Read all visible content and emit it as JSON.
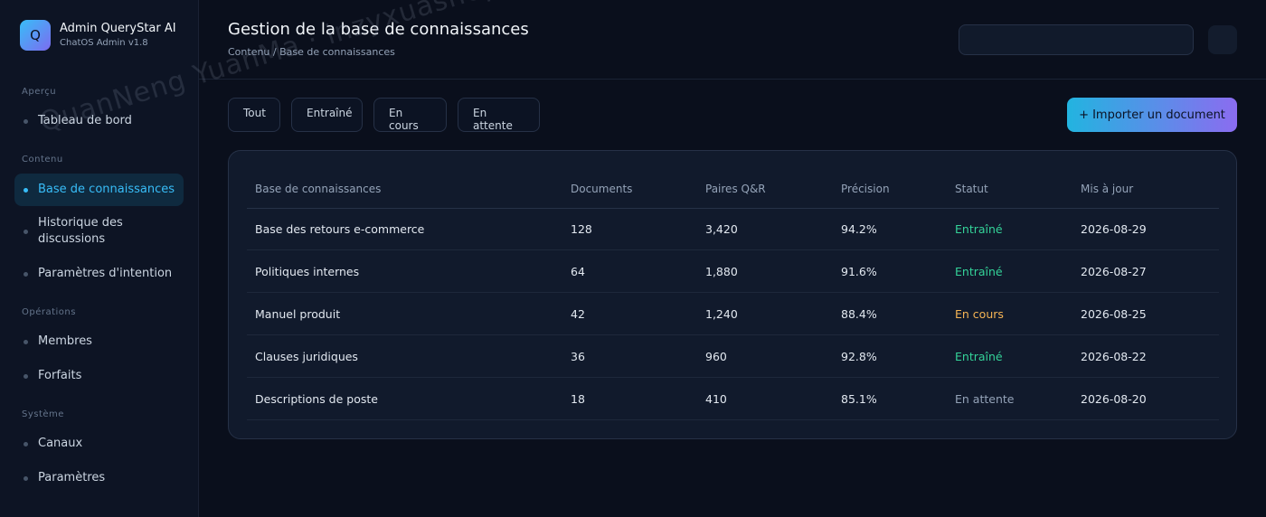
{
  "brand": {
    "logo_letter": "Q",
    "name": "Admin QueryStar AI",
    "version": "ChatOS Admin v1.8"
  },
  "sidebar": {
    "sections": [
      "Aperçu",
      "Contenu",
      "Opérations",
      "Système"
    ],
    "items": [
      {
        "label": "Tableau de bord",
        "active": false
      },
      {
        "label": "Base de connaissances",
        "active": true
      },
      {
        "label": "Historique des discussions",
        "active": false
      },
      {
        "label": "Paramètres d'intention",
        "active": false
      },
      {
        "label": "Membres",
        "active": false
      },
      {
        "label": "Forfaits",
        "active": false
      },
      {
        "label": "Canaux",
        "active": false
      },
      {
        "label": "Paramètres",
        "active": false
      }
    ]
  },
  "header": {
    "title": "Gestion de la base de connaissances",
    "breadcrumb": "Contenu / Base de connaissances",
    "search_placeholder": ""
  },
  "filters": [
    "Tout",
    "Entraîné",
    "En cours",
    "En attente"
  ],
  "import_button": "+ Importer un document",
  "table": {
    "columns": [
      "Base de connaissances",
      "Documents",
      "Paires Q&R",
      "Précision",
      "Statut",
      "Mis à jour"
    ],
    "rows": [
      [
        "Base des retours e-commerce",
        "128",
        "3,420",
        "94.2%",
        "Entraîné",
        "2026-08-29"
      ],
      [
        "Politiques internes",
        "64",
        "1,880",
        "91.6%",
        "Entraîné",
        "2026-08-27"
      ],
      [
        "Manuel produit",
        "42",
        "1,240",
        "88.4%",
        "En cours",
        "2026-08-25"
      ],
      [
        "Clauses juridiques",
        "36",
        "960",
        "92.8%",
        "Entraîné",
        "2026-08-22"
      ],
      [
        "Descriptions de poste",
        "18",
        "410",
        "85.1%",
        "En attente",
        "2026-08-20"
      ]
    ]
  },
  "colors": {
    "accent": "#38bdf8",
    "trained": "#34d399",
    "in_progress": "#f5b454",
    "waiting": "#94a3b8"
  },
  "watermark": "QuanNeng YuanMa · inzyxuashop.com"
}
